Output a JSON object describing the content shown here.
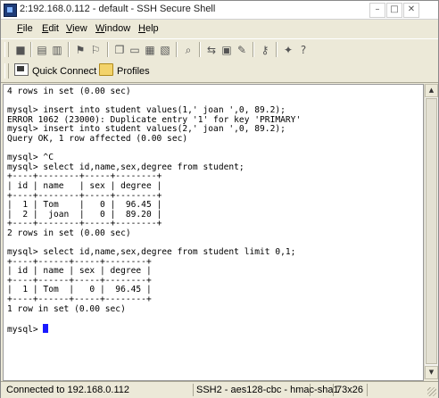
{
  "window": {
    "title": "2:192.168.0.112 - default - SSH Secure Shell",
    "controls": {
      "minimize": "–",
      "maximize": "□",
      "close": "✕"
    }
  },
  "menu": {
    "items": [
      {
        "label": "File",
        "accel": "F"
      },
      {
        "label": "Edit",
        "accel": "E"
      },
      {
        "label": "View",
        "accel": "V"
      },
      {
        "label": "Window",
        "accel": "W"
      },
      {
        "label": "Help",
        "accel": "H"
      }
    ]
  },
  "toolbar": {
    "icons": [
      {
        "name": "save-icon",
        "glyph": "■"
      },
      {
        "name": "print-icon",
        "glyph": "▤"
      },
      {
        "name": "print-preview-icon",
        "glyph": "▥"
      },
      {
        "name": "connect-icon",
        "glyph": "⚑"
      },
      {
        "name": "disconnect-icon",
        "glyph": "⚐"
      },
      {
        "name": "copy-icon",
        "glyph": "❐"
      },
      {
        "name": "paste-icon",
        "glyph": "▭"
      },
      {
        "name": "paste-special-icon",
        "glyph": "▦"
      },
      {
        "name": "clear-icon",
        "glyph": "▧"
      },
      {
        "name": "find-icon",
        "glyph": "⌕"
      },
      {
        "name": "file-transfer-icon",
        "glyph": "⇆"
      },
      {
        "name": "new-terminal-icon",
        "glyph": "▣"
      },
      {
        "name": "settings-icon",
        "glyph": "✎"
      },
      {
        "name": "key-icon",
        "glyph": "⚷"
      },
      {
        "name": "help-book-icon",
        "glyph": "✦"
      },
      {
        "name": "context-help-icon",
        "glyph": "?"
      }
    ]
  },
  "quickbar": {
    "quick_connect": "Quick Connect",
    "profiles": "Profiles"
  },
  "terminal": {
    "lines": [
      "4 rows in set (0.00 sec)",
      "",
      "mysql> insert into student values(1,' joan ',0, 89.2);",
      "ERROR 1062 (23000): Duplicate entry '1' for key 'PRIMARY'",
      "mysql> insert into student values(2,' joan ',0, 89.2);",
      "Query OK, 1 row affected (0.00 sec)",
      "",
      "mysql> ^C",
      "mysql> select id,name,sex,degree from student;",
      "+----+--------+-----+--------+",
      "| id | name   | sex | degree |",
      "+----+--------+-----+--------+",
      "|  1 | Tom    |   0 |  96.45 |",
      "|  2 |  joan  |   0 |  89.20 |",
      "+----+--------+-----+--------+",
      "2 rows in set (0.00 sec)",
      "",
      "mysql> select id,name,sex,degree from student limit 0,1;",
      "+----+------+-----+--------+",
      "| id | name | sex | degree |",
      "+----+------+-----+--------+",
      "|  1 | Tom  |   0 |  96.45 |",
      "+----+------+-----+--------+",
      "1 row in set (0.00 sec)",
      "",
      "mysql> "
    ]
  },
  "status": {
    "connection": "Connected to 192.168.0.112",
    "cipher": "SSH2 - aes128-cbc - hmac-sha1",
    "size": "73x26"
  }
}
